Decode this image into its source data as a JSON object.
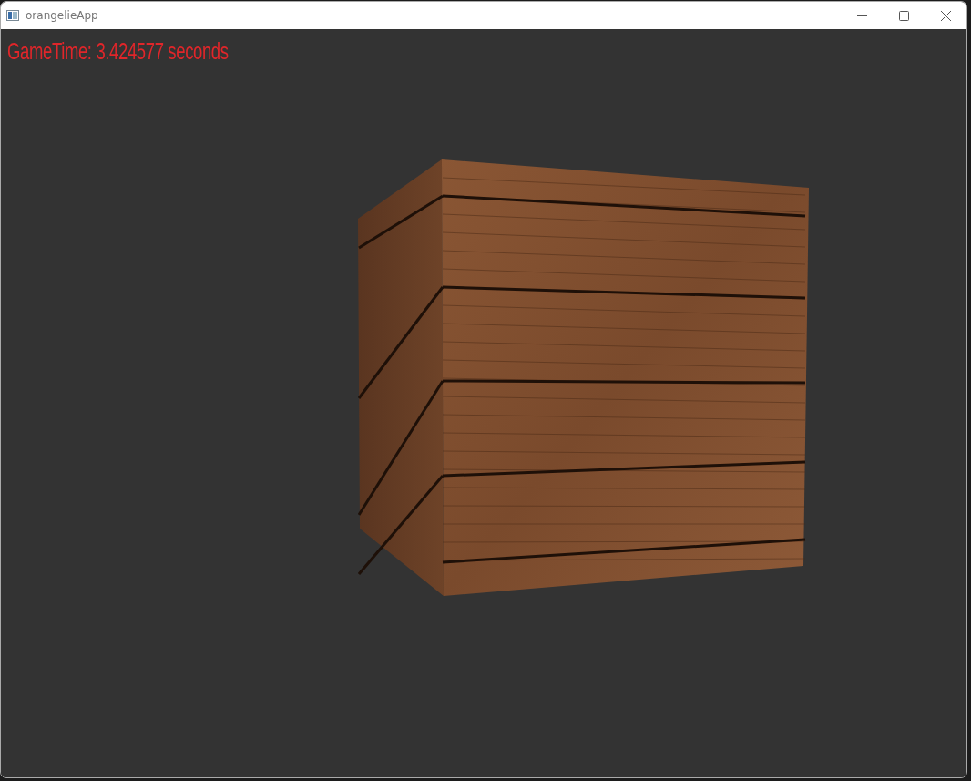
{
  "window": {
    "title": "orangelieApp"
  },
  "overlay": {
    "text": "GameTime: 3.424577 seconds"
  }
}
